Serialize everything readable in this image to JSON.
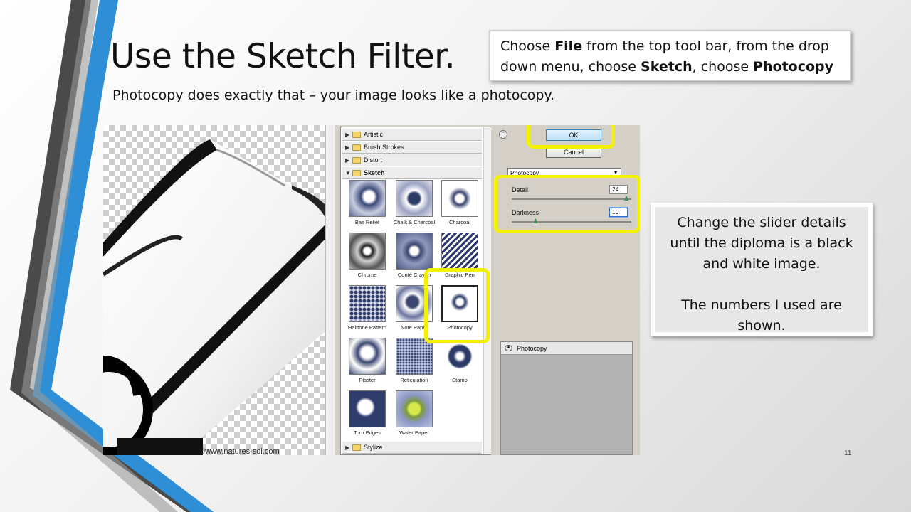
{
  "slide": {
    "title": "Use the Sketch Filter.",
    "subtitle": "Photocopy does exactly that – your image looks like a photocopy.",
    "page_number": "11"
  },
  "callout_top": {
    "t1": "Choose ",
    "b1": "File",
    "t2": " from the top tool bar, from the drop down menu, choose ",
    "b2": "Sketch",
    "t3": ", choose ",
    "b3": "Photocopy"
  },
  "callout_right": {
    "line1": "Change the slider details until the diploma is a black and white image.",
    "line2": "The numbers I used are shown."
  },
  "canvas": {
    "copyright": "©www.natures-sol.com"
  },
  "gallery": {
    "categories": [
      "Artistic",
      "Brush Strokes",
      "Distort",
      "Sketch",
      "Stylize"
    ],
    "filters": [
      "Bas Relief",
      "Chalk & Charcoal",
      "Charcoal",
      "Chrome",
      "Conté Crayon",
      "Graphic Pen",
      "Halftone Pattern",
      "Note Paper",
      "Photocopy",
      "Plaster",
      "Reticulation",
      "Stamp",
      "Torn Edges",
      "Water Paper"
    ],
    "selected": "Photocopy"
  },
  "panel": {
    "ok_label": "OK",
    "cancel_label": "Cancel",
    "filter_select": "Photocopy",
    "detail_label": "Detail",
    "detail_value": "24",
    "detail_fraction": 0.96,
    "darkness_label": "Darkness",
    "darkness_value": "10",
    "darkness_fraction": 0.2,
    "layer_name": "Photocopy"
  },
  "colors": {
    "highlight": "#f2f200",
    "stripe_blue": "#2e8fd6",
    "stripe_dark": "#4a4a4a"
  }
}
